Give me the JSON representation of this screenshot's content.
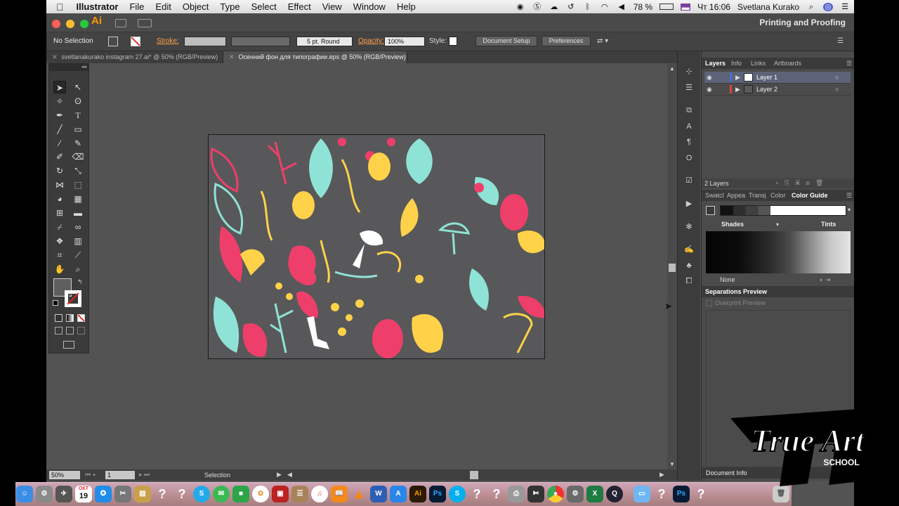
{
  "menubar": {
    "app": "Illustrator",
    "items": [
      "File",
      "Edit",
      "Object",
      "Type",
      "Select",
      "Effect",
      "View",
      "Window",
      "Help"
    ],
    "battery": "78 %",
    "clock": "Чт 16:06",
    "user": "Svetlana Kurako"
  },
  "appbar": {
    "logo": "Ai",
    "workspace": "Printing and Proofing"
  },
  "control": {
    "selection": "No Selection",
    "stroke_label": "Stroke:",
    "brush": "5 pt. Round",
    "opacity_label": "Opacity:",
    "opacity_value": "100%",
    "style_label": "Style:",
    "document_setup": "Document Setup",
    "preferences": "Preferences"
  },
  "tabs": [
    {
      "label": "svetlanakurako instagram 27.ai* @ 50% (RGB/Preview)",
      "active": false
    },
    {
      "label": "Осенний фон для типографии.eps @ 50% (RGB/Preview)",
      "active": true
    }
  ],
  "statusbar": {
    "zoom": "50%",
    "page": "1",
    "tool": "Selection"
  },
  "layers_panel": {
    "tabs": [
      "Layers",
      "Info",
      "Links",
      "Artboards"
    ],
    "layers": [
      {
        "name": "Layer 1",
        "color": "#4a6fd8"
      },
      {
        "name": "Layer 2",
        "color": "#e04040"
      }
    ],
    "count": "2 Layers"
  },
  "color_panel": {
    "tabs": [
      "Swatcl",
      "Appea",
      "Transį",
      "Color",
      "Color Guide"
    ],
    "shades": "Shades",
    "tints": "Tints",
    "none": "None"
  },
  "separations": {
    "title": "Separations Preview",
    "overprint": "Overprint Preview"
  },
  "document_info": "Document Info",
  "artwork_colors": {
    "bg": "#58585a",
    "pink": "#ee3f6a",
    "mint": "#8fe3d6",
    "yellow": "#ffd24a",
    "white": "#ffffff"
  },
  "dock": {
    "calendar_month": "ОКТ",
    "calendar_day": "19"
  },
  "watermark": {
    "line1": "True Art",
    "line2": "SCHOOL"
  }
}
